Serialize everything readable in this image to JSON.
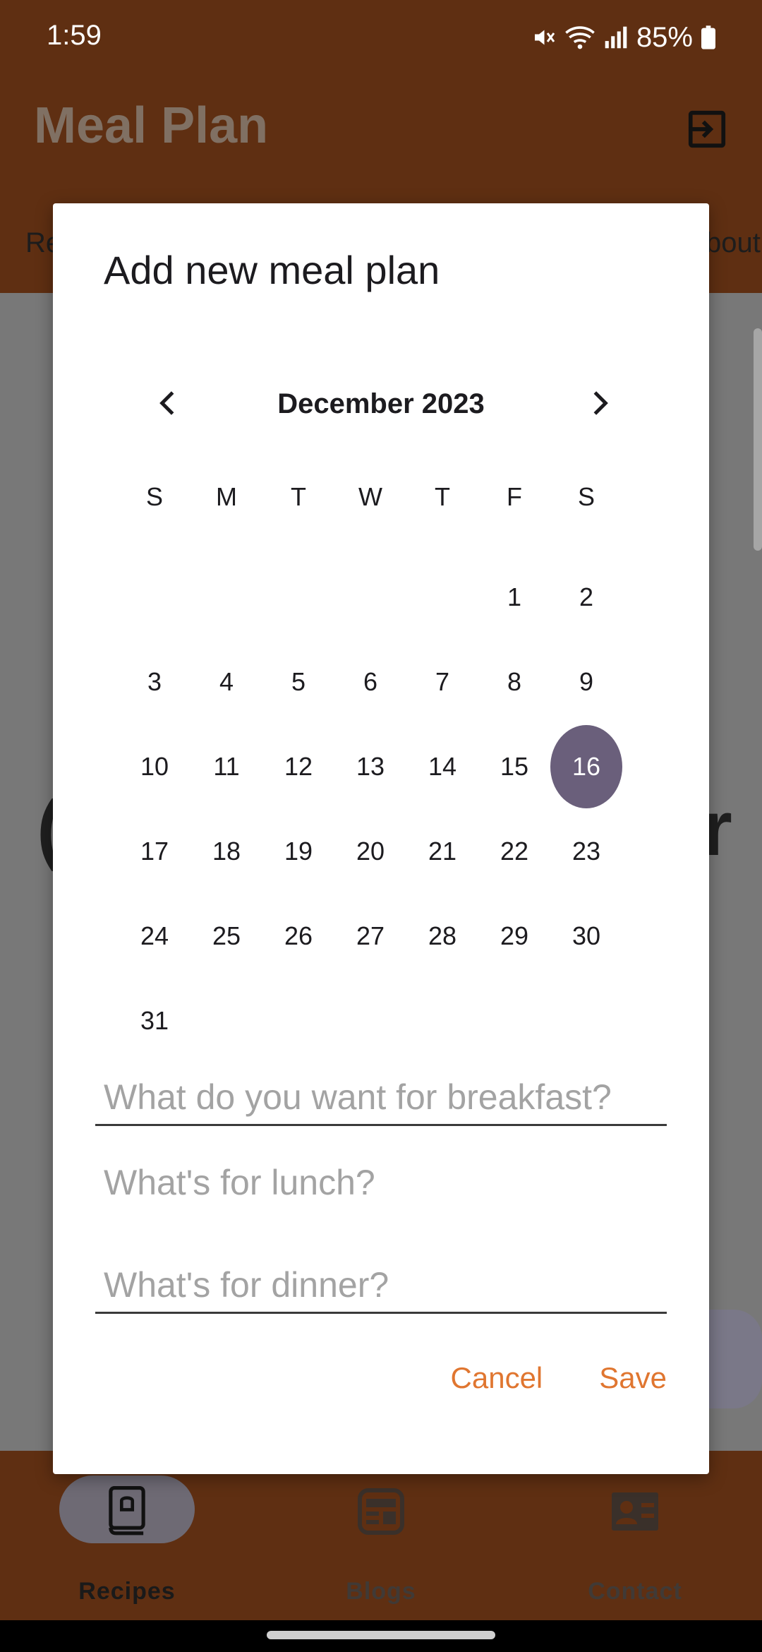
{
  "status_bar": {
    "time": "1:59",
    "battery": "85%",
    "icons": [
      "mute-icon",
      "wifi-icon",
      "signal-icon",
      "battery-icon"
    ]
  },
  "app_bar": {
    "title": "Meal Plan",
    "exit_icon": "exit-icon"
  },
  "tabs": {
    "left_partial": "Re",
    "right_partial": "bout"
  },
  "background": {
    "left_letter": "(",
    "right_letter": "r"
  },
  "dialog": {
    "title": "Add new meal plan",
    "calendar": {
      "month_label": "December 2023",
      "weekdays": [
        "S",
        "M",
        "T",
        "W",
        "T",
        "F",
        "S"
      ],
      "weeks": [
        [
          "",
          "",
          "",
          "",
          "",
          "1",
          "2"
        ],
        [
          "3",
          "4",
          "5",
          "6",
          "7",
          "8",
          "9"
        ],
        [
          "10",
          "11",
          "12",
          "13",
          "14",
          "15",
          "16"
        ],
        [
          "17",
          "18",
          "19",
          "20",
          "21",
          "22",
          "23"
        ],
        [
          "24",
          "25",
          "26",
          "27",
          "28",
          "29",
          "30"
        ],
        [
          "31",
          "",
          "",
          "",
          "",
          "",
          ""
        ]
      ],
      "selected_day": "16"
    },
    "fields": {
      "breakfast_placeholder": "What do you want for breakfast?",
      "lunch_placeholder": "What's for lunch?",
      "dinner_placeholder": "What's for dinner?"
    },
    "actions": {
      "cancel": "Cancel",
      "save": "Save"
    },
    "colors": {
      "accent": "#e07630",
      "selected_day": "#6a5f7b"
    }
  },
  "bottom_nav": {
    "items": [
      {
        "label": "Recipes",
        "icon": "recipe-book-icon",
        "active": true
      },
      {
        "label": "Blogs",
        "icon": "blog-icon",
        "active": false
      },
      {
        "label": "Contact",
        "icon": "contact-card-icon",
        "active": false
      }
    ]
  }
}
